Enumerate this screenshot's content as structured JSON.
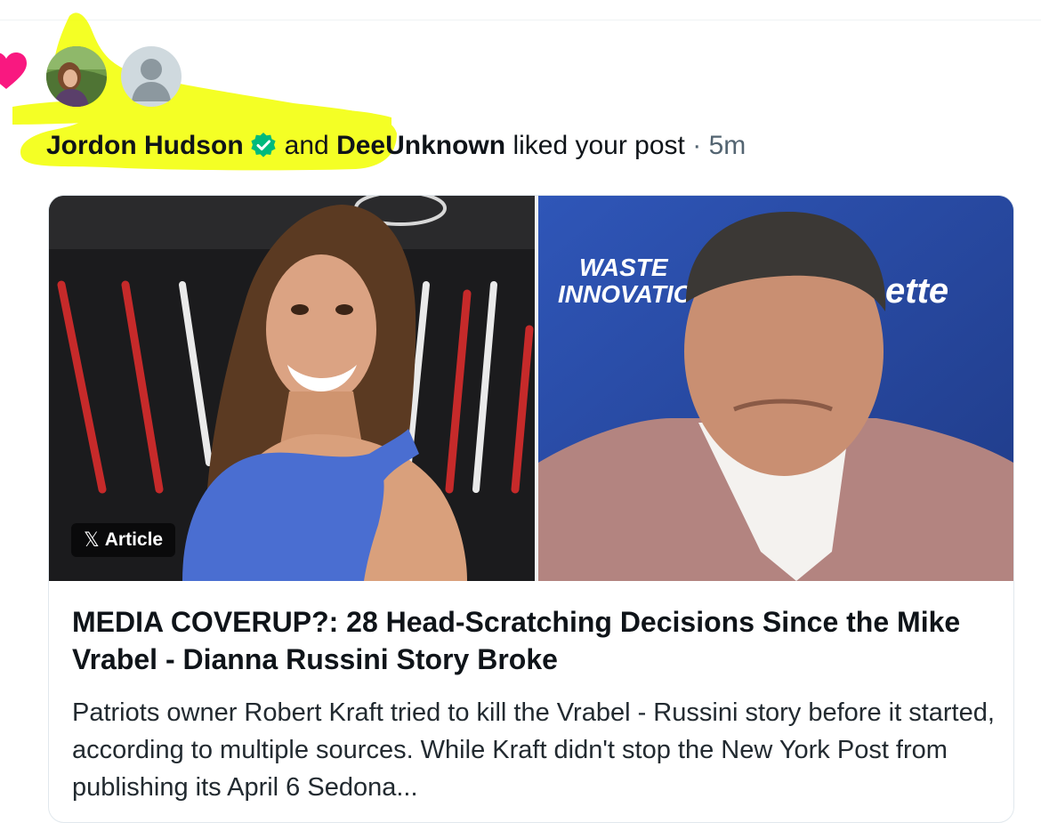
{
  "notification": {
    "user1": "Jordon Hudson",
    "connector": "and",
    "user2": "DeeUnknown",
    "action": "liked your post",
    "separator": "·",
    "time": "5m"
  },
  "article": {
    "badge_x": "𝕏",
    "badge_label": "Article",
    "title": "MEDIA COVERUP?: 28 Head-Scratching Decisions Since the Mike Vrabel - Dianna Russini Story Broke",
    "description": "Patriots owner Robert Kraft tried to kill the Vrabel - Russini story before it started, according to multiple sources. While Kraft didn't stop the New York Post from publishing its April 6 Sedona...",
    "backdrop_text_1": "WASTE",
    "backdrop_text_2": "INNOVATIO",
    "backdrop_text_3": "ette"
  },
  "colors": {
    "like_heart": "#f91880",
    "verified_badge": "#00ba7c",
    "highlighter": "#f3ff00",
    "time_text": "#536471"
  },
  "icons": {
    "like": "heart-icon",
    "verified": "verified-badge-icon",
    "article": "x-logo-icon"
  }
}
